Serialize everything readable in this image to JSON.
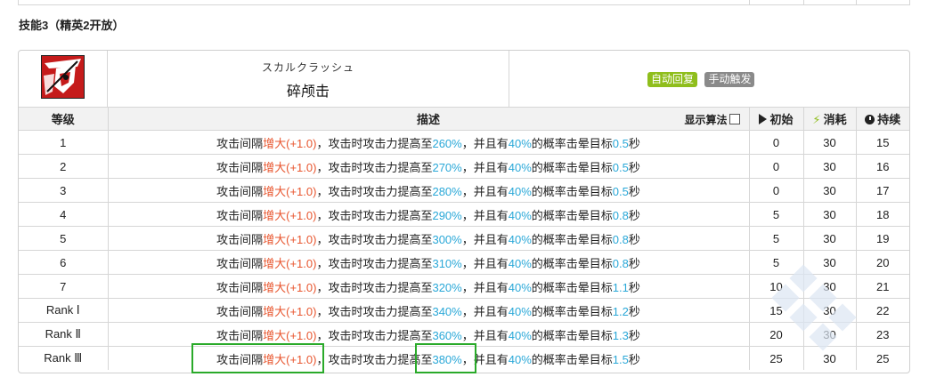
{
  "section_title": "技能3（精英2开放）",
  "skill": {
    "jp_name": "スカルクラッシュ",
    "cn_name": "碎颅击",
    "icon": "skull-crush-skill-icon",
    "tags": [
      {
        "label": "自动回复",
        "color": "#8fbe1c"
      },
      {
        "label": "手动触发",
        "color": "#8a8a8a"
      }
    ]
  },
  "table": {
    "headers": {
      "level": "等级",
      "description": "描述",
      "formula_toggle": "显示算法",
      "initial": "初始",
      "cost": "消耗",
      "duration": "持续"
    },
    "description_template": {
      "p1": "攻击间隔",
      "interval_change": "增大(+1.0)",
      "p2": "，攻击时攻击力提高至",
      "p3": "，并且有",
      "stun_chance": "40%",
      "p4": "的概率击晕目标",
      "p5": "秒"
    },
    "rows": [
      {
        "level": "1",
        "atk": "260%",
        "stun": "0.5",
        "initial": "0",
        "cost": "30",
        "duration": "15"
      },
      {
        "level": "2",
        "atk": "270%",
        "stun": "0.5",
        "initial": "0",
        "cost": "30",
        "duration": "16"
      },
      {
        "level": "3",
        "atk": "280%",
        "stun": "0.5",
        "initial": "0",
        "cost": "30",
        "duration": "17"
      },
      {
        "level": "4",
        "atk": "290%",
        "stun": "0.8",
        "initial": "5",
        "cost": "30",
        "duration": "18"
      },
      {
        "level": "5",
        "atk": "300%",
        "stun": "0.8",
        "initial": "5",
        "cost": "30",
        "duration": "19"
      },
      {
        "level": "6",
        "atk": "310%",
        "stun": "0.8",
        "initial": "5",
        "cost": "30",
        "duration": "20"
      },
      {
        "level": "7",
        "atk": "320%",
        "stun": "1.1",
        "initial": "10",
        "cost": "30",
        "duration": "21"
      },
      {
        "level": "Rank Ⅰ",
        "atk": "340%",
        "stun": "1.2",
        "initial": "15",
        "cost": "30",
        "duration": "22"
      },
      {
        "level": "Rank Ⅱ",
        "atk": "360%",
        "stun": "1.3",
        "initial": "20",
        "cost": "30",
        "duration": "23"
      },
      {
        "level": "Rank Ⅲ",
        "atk": "380%",
        "stun": "1.5",
        "initial": "25",
        "cost": "30",
        "duration": "25"
      }
    ]
  },
  "colors": {
    "increase_red": "#e8562f",
    "value_blue": "#2aa8d8",
    "highlight_green": "#2aaa2a"
  }
}
